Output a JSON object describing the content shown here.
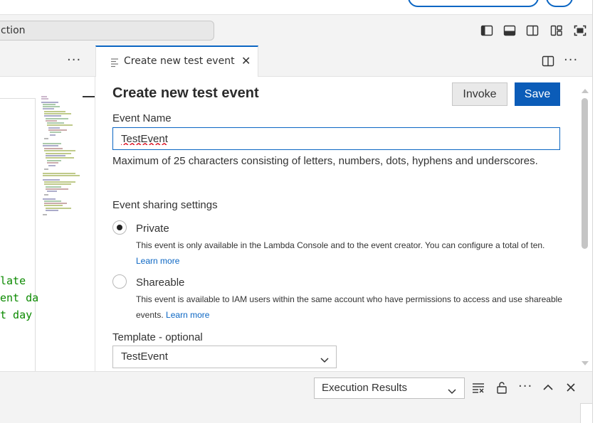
{
  "toolbar": {
    "search_text": "ction",
    "layout_icons": [
      "toggle-primary-sidebar-icon",
      "toggle-panel-icon",
      "toggle-secondary-sidebar-icon",
      "customize-layout-icon",
      "fullscreen-icon"
    ]
  },
  "tabs": {
    "more_label": "···",
    "active_tab_label": "Create new test event",
    "close_glyph": "✕"
  },
  "left_editor": {
    "code_lines": [
      "late",
      "ent da",
      "t day"
    ]
  },
  "form": {
    "title": "Create new test event",
    "invoke_label": "Invoke",
    "save_label": "Save",
    "event_name_label": "Event Name",
    "event_name_value": "TestEvent",
    "event_name_help": "Maximum of 25 characters consisting of letters, numbers, dots, hyphens and underscores.",
    "sharing_label": "Event sharing settings",
    "private_label": "Private",
    "private_desc": "This event is only available in the Lambda Console and to the event creator. You can configure a total of ten.",
    "shareable_label": "Shareable",
    "shareable_desc": "This event is available to IAM users within the same account who have permissions to access and use shareable events.",
    "learn_more": "Learn more",
    "selected_sharing": "Private",
    "template_label": "Template - optional",
    "template_value": "TestEvent"
  },
  "bottom_panel": {
    "results_value": "Execution Results",
    "more_label": "···"
  },
  "colors": {
    "accent": "#0b66c3",
    "save_bg": "#0b5cb8",
    "code_green": "#0b8a00"
  }
}
